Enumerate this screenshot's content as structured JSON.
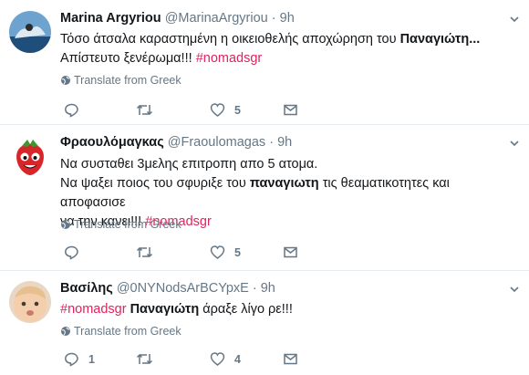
{
  "tweets": [
    {
      "name": "Marina Argyriou",
      "handle": "@MarinaArgyriou",
      "dot": "·",
      "time": "9h",
      "line1": "Τόσο άτσαλα καραστημένη η οικειοθελής αποχώρηση  του ",
      "line1_bold": "Παναγιώτη",
      "line1_tail": "...",
      "line2": "Απίστευτο ξενέρωμα!!! ",
      "hashtag": "#nomadsgr",
      "translate": "Translate from Greek",
      "replies": "",
      "retweets": "",
      "likes": "5"
    },
    {
      "name": "Φραουλόμαγκας",
      "handle": "@Fraoulomagas",
      "dot": "·",
      "time": "9h",
      "line1": "Να συσταθει 3μελης επιτροπη απο 5 ατομα.",
      "line2_pre": "Να ψαξει ποιος του σφυριξε του ",
      "line2_bold": "παναγιωτη",
      "line2_post": " τις θεαματικοτητες και αποφασισε",
      "line3": "να την κανει!!! ",
      "hashtag": "#nomadsgr",
      "translate": "Translate from Greek",
      "replies": "",
      "retweets": "",
      "likes": "5"
    },
    {
      "name": "Βασίλης",
      "handle": "@0NYNodsArBCYpxE",
      "dot": "·",
      "time": "9h",
      "hashtag": "#nomadsgr",
      "line1_bold": "Παναγιώτη",
      "line1_post": " άραξε λίγο ρε!!!",
      "translate": "Translate from Greek",
      "replies": "1",
      "retweets": "",
      "likes": "4"
    }
  ],
  "colors": {
    "accent": "#e0245e",
    "muted": "#657786",
    "divider": "#e6ecf0"
  },
  "icons": [
    "chevron-down-icon",
    "globe-icon",
    "reply-icon",
    "retweet-icon",
    "like-icon",
    "message-icon"
  ]
}
